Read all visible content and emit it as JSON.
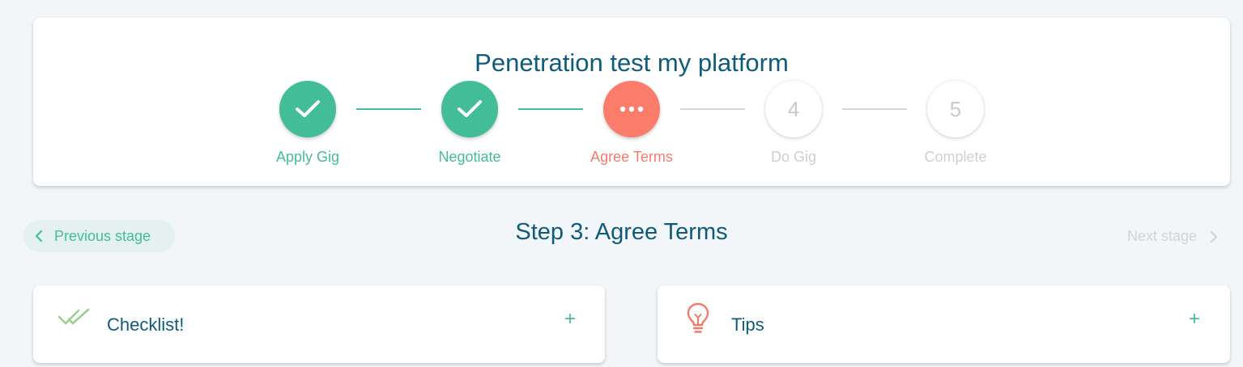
{
  "gig": {
    "title": "Penetration test my platform"
  },
  "stepper": {
    "steps": [
      {
        "label": "Apply Gig",
        "state": "done",
        "marker": "check-icon"
      },
      {
        "label": "Negotiate",
        "state": "done",
        "marker": "check-icon"
      },
      {
        "label": "Agree Terms",
        "state": "current",
        "marker": "more-dots-icon"
      },
      {
        "label": "Do Gig",
        "state": "pending",
        "number": "4"
      },
      {
        "label": "Complete",
        "state": "pending",
        "number": "5"
      }
    ]
  },
  "stage_nav": {
    "previous_label": "Previous stage",
    "title": "Step 3: Agree Terms",
    "next_label": "Next stage"
  },
  "panels": {
    "checklist": {
      "title": "Checklist!",
      "toggle": "+",
      "icon": "double-check-icon"
    },
    "tips": {
      "title": "Tips",
      "toggle": "+",
      "icon": "lightbulb-icon"
    }
  },
  "colors": {
    "done": "#43bc98",
    "current": "#fc7c6c",
    "pending": "#cfcfcf",
    "heading": "#0f5b7a",
    "background": "#f2f6f8"
  }
}
